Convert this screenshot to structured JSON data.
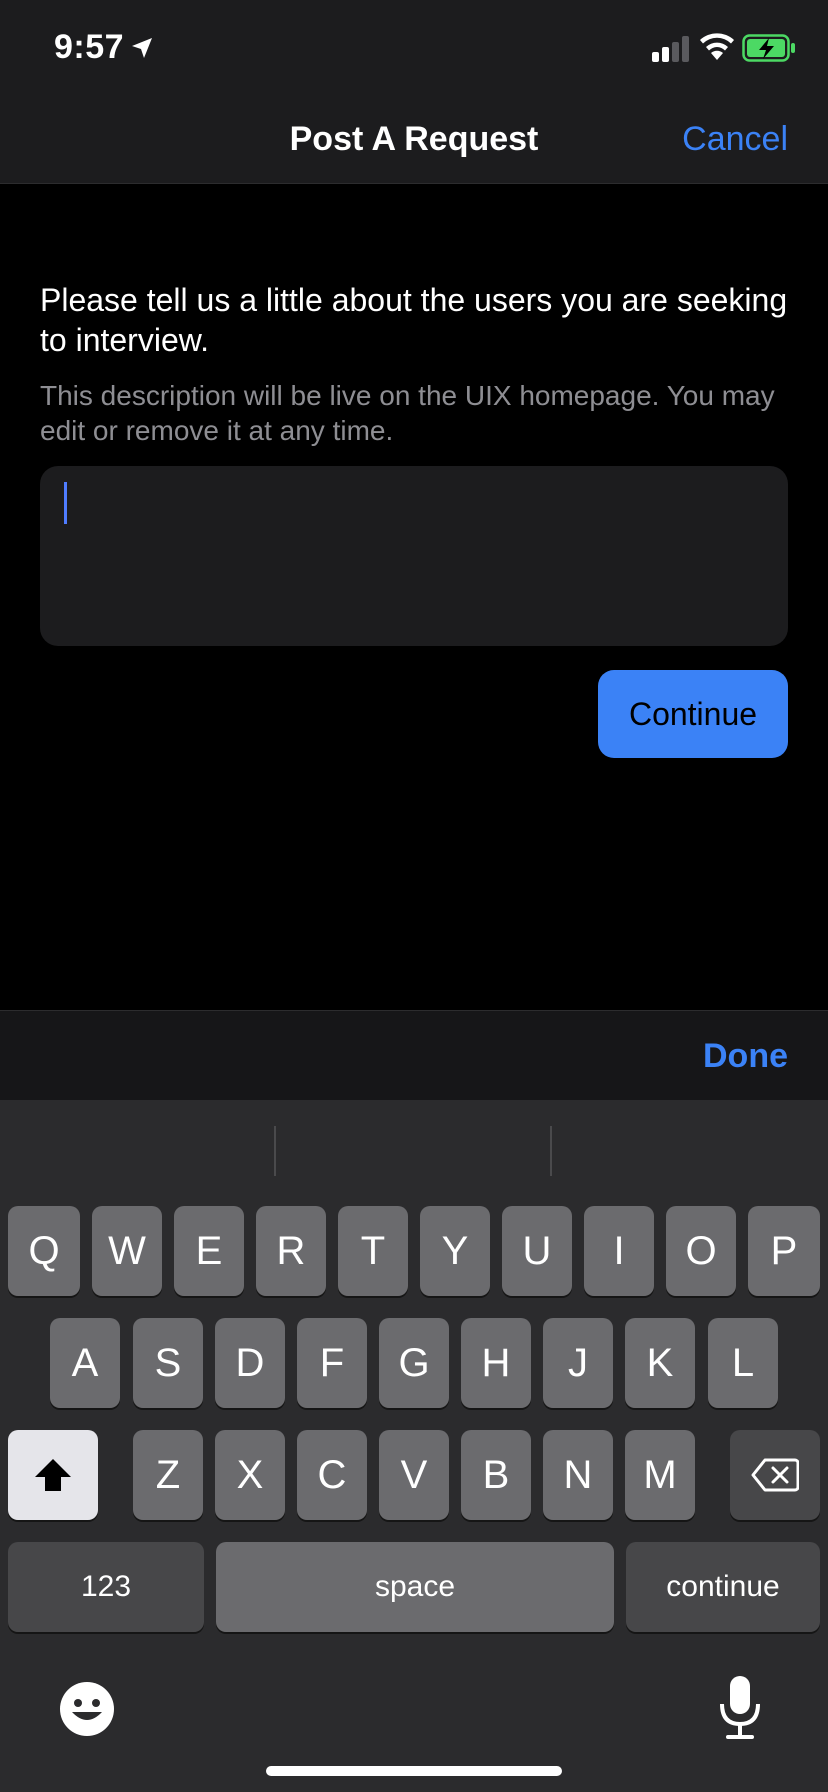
{
  "status_bar": {
    "time": "9:57"
  },
  "nav": {
    "title": "Post A Request",
    "cancel_label": "Cancel"
  },
  "content": {
    "prompt": "Please tell us a little about the users you are seeking to interview.",
    "hint": "This description will be live on the UIX homepage. You may edit or remove it at any time.",
    "description_value": "",
    "continue_label": "Continue"
  },
  "toolbar": {
    "done_label": "Done"
  },
  "keyboard": {
    "row1": [
      "Q",
      "W",
      "E",
      "R",
      "T",
      "Y",
      "U",
      "I",
      "O",
      "P"
    ],
    "row2": [
      "A",
      "S",
      "D",
      "F",
      "G",
      "H",
      "J",
      "K",
      "L"
    ],
    "row3": [
      "Z",
      "X",
      "C",
      "V",
      "B",
      "N",
      "M"
    ],
    "numbers_label": "123",
    "space_label": "space",
    "return_label": "continue"
  },
  "colors": {
    "accent": "#3b82f6",
    "background": "#000000",
    "keyboard": "#2b2b2d"
  },
  "icons": [
    "location-arrow-icon",
    "signal-icon",
    "wifi-icon",
    "battery-charging-icon",
    "shift-icon",
    "backspace-icon",
    "emoji-icon",
    "microphone-icon"
  ]
}
